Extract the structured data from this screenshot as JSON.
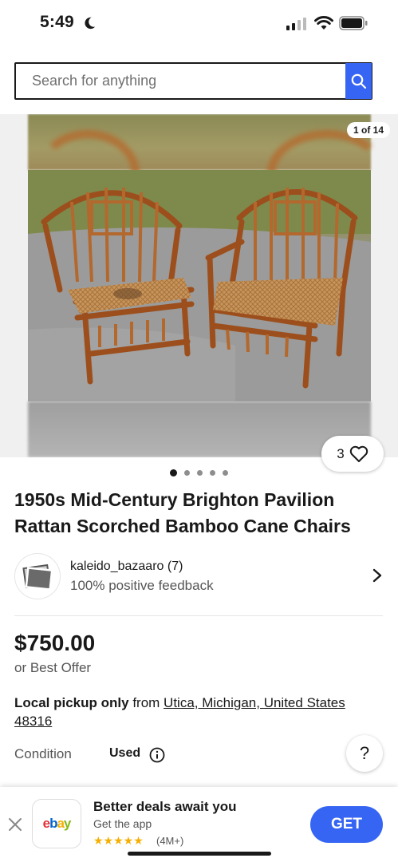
{
  "status_bar": {
    "time": "5:49"
  },
  "search": {
    "placeholder": "Search for anything"
  },
  "gallery": {
    "counter": "1 of 14",
    "watch_count": "3",
    "dot_count": 5,
    "active_dot": 0
  },
  "listing": {
    "title": "1950s Mid-Century Brighton Pavilion Rattan Scorched Bamboo Cane Chairs",
    "price": "$750.00",
    "price_note": "or Best Offer",
    "pickup_bold": "Local pickup only",
    "pickup_from": " from ",
    "pickup_location": "Utica, Michigan, United States 48316",
    "condition_label": "Condition",
    "condition_value": "Used",
    "help_label": "?"
  },
  "seller": {
    "name": "kaleido_bazaaro (7)",
    "feedback": "100% positive feedback"
  },
  "app_banner": {
    "logo_text": "ebay",
    "title": "Better deals await you",
    "subtitle": "Get the app",
    "stars": "★★★★★",
    "reviews": "(4M+)",
    "cta": "GET"
  },
  "colors": {
    "accent": "#3665f3",
    "star": "#f5af02",
    "text": "#191919"
  }
}
